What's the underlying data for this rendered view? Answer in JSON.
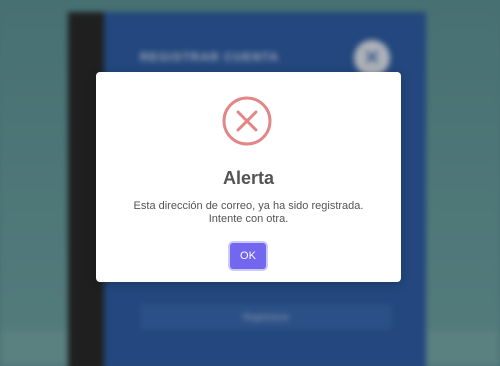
{
  "background": {
    "panel_title": "REGISTRAR CUENTA",
    "close_symbol": "✕",
    "register_button_label": "Registrarse"
  },
  "alert": {
    "icon": "error-x-circle-icon",
    "title": "Alerta",
    "message_line1": "Esta dirección de correo, ya ha sido registrada.",
    "message_line2": "Intente con otra.",
    "ok_label": "OK",
    "accent_color": "#7367f0",
    "icon_color": "#e28686"
  }
}
